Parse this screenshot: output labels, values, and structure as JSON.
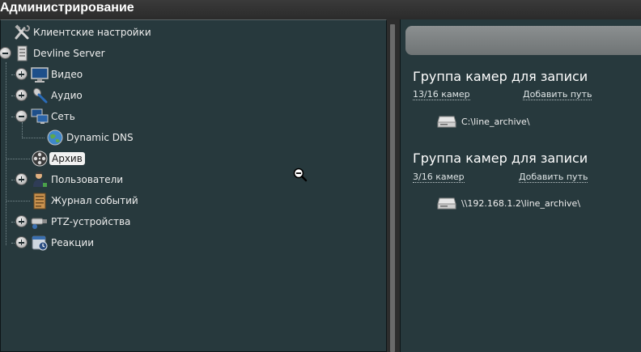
{
  "window": {
    "title": "Администрирование"
  },
  "tree": {
    "client_settings": "Клиентские настройки",
    "server": "Devline Server",
    "video": "Видео",
    "audio": "Аудио",
    "network": "Сеть",
    "dynamic_dns": "Dynamic DNS",
    "archive": "Архив",
    "users": "Пользователи",
    "event_log": "Журнал событий",
    "ptz": "PTZ-устройства",
    "reactions": "Реакции"
  },
  "groups": [
    {
      "title": "Группа камер для записи",
      "count": "13/16 камер",
      "add_path": "Добавить путь",
      "path": "C:\\line_archive\\"
    },
    {
      "title": "Группа камер для записи",
      "count": "3/16 камер",
      "add_path": "Добавить путь",
      "path": "\\\\192.168.1.2\\line_archive\\"
    }
  ],
  "colors": {
    "panel": "#27393d",
    "title_bar": "#333333",
    "toolbar": "#7d8283"
  }
}
